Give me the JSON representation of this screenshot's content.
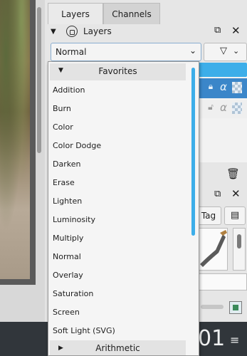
{
  "docker": {
    "tabs": [
      {
        "label": "Layers"
      },
      {
        "label": "Channels"
      }
    ],
    "layers_title": "Layers"
  },
  "blend_mode": {
    "selected": "Normal",
    "popup": {
      "group_favorites": "Favorites",
      "options": [
        "Addition",
        "Burn",
        "Color",
        "Color Dodge",
        "Darken",
        "Erase",
        "Lighten",
        "Luminosity",
        "Multiply",
        "Normal",
        "Overlay",
        "Saturation",
        "Screen",
        "Soft Light (SVG)"
      ],
      "group_arithmetic": "Arithmetic"
    }
  },
  "brush_presets": {
    "tag_label": "Tag"
  },
  "status": {
    "number_text": "01"
  },
  "colors": {
    "accent_blue": "#3daee9",
    "selected_row": "#3b86c9",
    "statusbar_bg": "#31363b"
  },
  "icons": [
    "collapse-triangle-icon",
    "lock-icon",
    "float-icon",
    "close-icon",
    "chevron-down-icon",
    "filter-icon",
    "alpha-lock-icon",
    "transparency-checker-icon",
    "trash-icon",
    "menu-icon",
    "hamburger-icon",
    "reset-icon"
  ]
}
